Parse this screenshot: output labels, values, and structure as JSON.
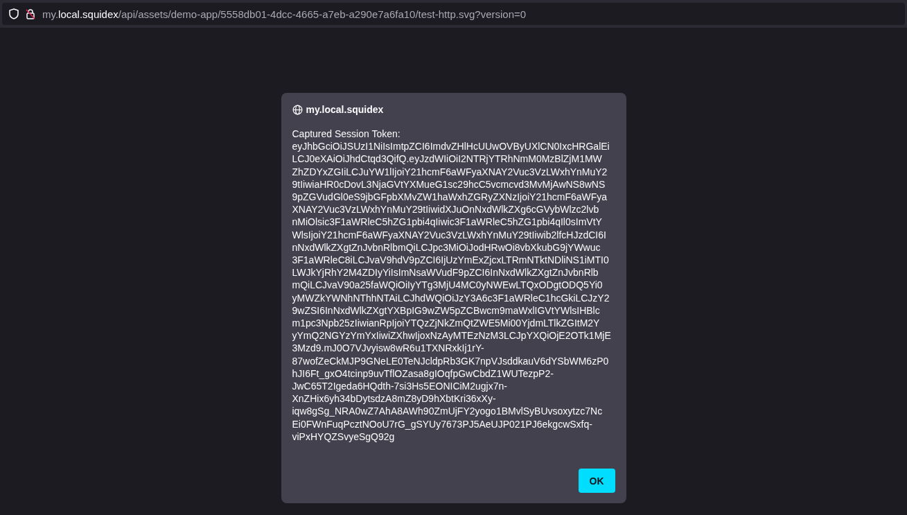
{
  "address_bar": {
    "subdomain": "my.",
    "domain": "local.squidex",
    "path": "/api/assets/demo-app/5558db01-4dcc-4665-a7eb-a290e7a6fa10/test-http.svg?version=0"
  },
  "dialog": {
    "origin": "my.local.squidex",
    "label": "Captured Session Token:",
    "token_lines": [
      "eyJhbGciOiJSUzI1NiIsImtpZCI6ImdvZHlHcUUwOVByUXlCN0IxcHRGalEi",
      "LCJ0eXAiOiJhdCtqd3QifQ.eyJzdWIiOiI2NTRjYTRhNmM0MzBlZjM1MW",
      "ZhZDYxZGIiLCJuYW1lIjoiY21hcmF6aWFyaXNAY2Vuc3VzLWxhYnMuY2",
      "9tIiwiaHR0cDovL3NjaGVtYXMueG1sc29hcC5vcmcvd3MvMjAwNS8wNS",
      "9pZGVudGl0eS9jbGFpbXMvZW1haWxhZGRyZXNzIjoiY21hcmF6aWFya",
      "XNAY2Vuc3VzLWxhYnMuY29tIiwidXJuOnNxdWlkZXg6cGVybWlzc2lvb",
      "nMiOlsic3F1aWRleC5hZG1pbi4qIiwic3F1aWRleC5hZG1pbi4qIl0sImVtY",
      "WlsIjoiY21hcmF6aWFyaXNAY2Vuc3VzLWxhYnMuY29tIiwib2lfcHJzdCI6I",
      "nNxdWlkZXgtZnJvbnRlbmQiLCJpc3MiOiJodHRwOi8vbXkubG9jYWwuc",
      "3F1aWRleC8iLCJvaV9hdV9pZCI6IjUzYmExZjcxLTRmNTktNDliNS1iMTI0",
      "LWJkYjRhY2M4ZDIyYiIsImNsaWVudF9pZCI6InNxdWlkZXgtZnJvbnRlb",
      "mQiLCJvaV90a25faWQiOiIyYTg3MjU4MC0yNWEwLTQxODgtODQ5Yi0",
      "yMWZkYWNhNThhNTAiLCJhdWQiOiJzY3A6c3F1aWRleC1hcGkiLCJzY2",
      "9wZSI6InNxdWlkZXgtYXBpIG9wZW5pZCBwcm9maWxlIGVtYWlsIHBlc",
      "m1pc3Npb25zIiwianRpIjoiYTQzZjNkZmQtZWE5Mi00YjdmLTlkZGItM2Y",
      "yYmQ2NGYzYmYxIiwiZXhwIjoxNzAyMTEzNzM3LCJpYXQiOjE2OTk1MjE",
      "3Mzd9.mJ0O7VJvyisw8wR6u1TXNRxkIj1rY-",
      "87wofZeCkMJP9GNeLE0TeNJcldpRb3GK7npVJsddkauV6dYSbWM6zP0",
      "hJI6Ft_gxO4tcinp9uvTflOZasa8gIOqfpGwCbdZ1WUTezpP2-",
      "JwC65T2Igeda6HQdth-7si3Hs5EONICiM2ugjx7n-",
      "XnZHix6yh34bDytsdzA8mZ8yD9hXbtKri36xXy-",
      "iqw8gSg_NRA0wZ7AhA8AWh90ZmUjFY2yogo1BMvlSyBUvsoxytzc7Nc",
      "Ei0FWnFuqPcztNOoU7rG_gSYUy7673PJ5AeUJP021PJ6ekgcwSxfq-",
      "viPxHYQZSvyeSgQ92g"
    ],
    "button": "OK"
  }
}
